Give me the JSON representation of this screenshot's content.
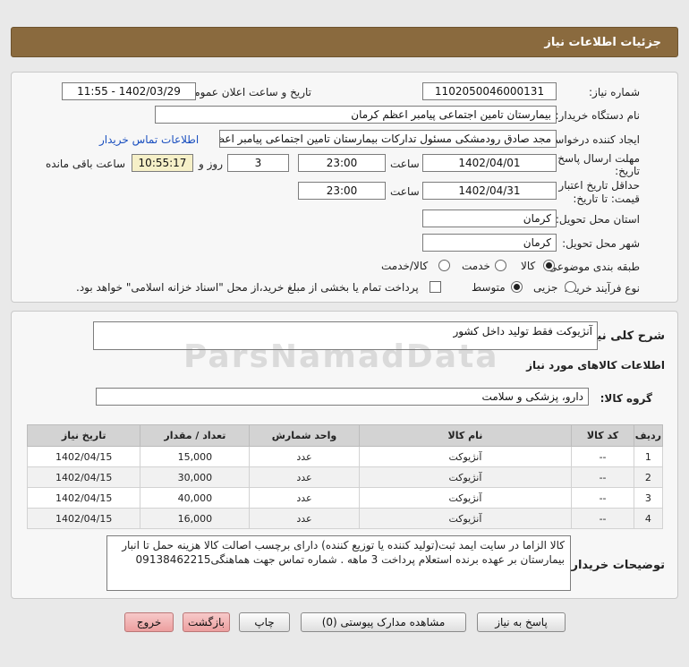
{
  "header": {
    "title": "جزئیات اطلاعات نیاز"
  },
  "form": {
    "need_number_label": "شماره نیاز:",
    "need_number": "1102050046000131",
    "announce_label": "تاریخ و ساعت اعلان عمومی:",
    "announce_value": "1402/03/29 - 11:55",
    "buyer_org_label": "نام دستگاه خریدار:",
    "buyer_org": "بیمارستان تامین اجتماعی پیامبر اعظم کرمان",
    "creator_label": "ایجاد کننده درخواست:",
    "creator": "مجد صادق  رودمشکی مسئول تدارکات بیمارستان تامین اجتماعی پیامبر اعظم کرمان",
    "contact_link": "اطلاعات تماس خریدار",
    "deadline_label_1": "مهلت ارسال پاسخ: تا",
    "deadline_label_2": "تاریخ:",
    "deadline_date": "1402/04/01",
    "time_label": "ساعت",
    "deadline_time": "23:00",
    "days_value": "3",
    "days_label": "روز و",
    "remaining_time": "10:55:17",
    "remaining_label": "ساعت باقی مانده",
    "validity_label_1": "حداقل تاریخ اعتبار",
    "validity_label_2": "قیمت: تا تاریخ:",
    "validity_date": "1402/04/31",
    "validity_time": "23:00",
    "province_label": "استان محل تحویل:",
    "province": "کرمان",
    "city_label": "شهر محل تحویل:",
    "city": "کرمان",
    "category_label": "طبقه بندی موضوعی:",
    "category_options": [
      "کالا",
      "خدمت",
      "کالا/خدمت"
    ],
    "process_label": "نوع فرآیند خرید :",
    "process_options": [
      "جزیی",
      "متوسط"
    ],
    "payment_note": "پرداخت تمام یا بخشی از مبلغ خرید،از محل \"اسناد خزانه اسلامی\" خواهد بود."
  },
  "summary": {
    "need_desc_label": "شرح کلی نیاز:",
    "need_desc": "آنژیوکت فقط تولید داخل کشور",
    "goods_info_title": "اطلاعات کالاهای مورد نیاز",
    "goods_group_label": "گروه کالا:",
    "goods_group": "دارو، پزشکی و سلامت"
  },
  "table": {
    "headers": [
      "ردیف",
      "کد کالا",
      "نام کالا",
      "واحد شمارش",
      "تعداد / مقدار",
      "تاریخ نیاز"
    ],
    "rows": [
      [
        "1",
        "--",
        "آنژیوکت",
        "عدد",
        "15,000",
        "1402/04/15"
      ],
      [
        "2",
        "--",
        "آنژیوکت",
        "عدد",
        "30,000",
        "1402/04/15"
      ],
      [
        "3",
        "--",
        "آنژیوکت",
        "عدد",
        "40,000",
        "1402/04/15"
      ],
      [
        "4",
        "--",
        "آنژیوکت",
        "عدد",
        "16,000",
        "1402/04/15"
      ]
    ]
  },
  "buyer_notes": {
    "label": "توضیحات خریدار:",
    "line1": "کالا الزاما در سایت ایمد ثبت(تولید کننده یا توزیع کننده) دارای برچسب اصالت کالا هزینه حمل تا انبار",
    "line2": "بیمارستان بر عهده برنده استعلام پرداخت 3 ماهه . شماره تماس جهت هماهنگی09138462215"
  },
  "buttons": {
    "reply": "پاسخ به نیاز",
    "attachments": "مشاهده مدارک پیوستی (0)",
    "print": "چاپ",
    "back": "بازگشت",
    "exit": "خروج"
  },
  "watermark": "ParsNamadData",
  "colors": {
    "header": "#8a6a3e",
    "link": "#1a4fbf",
    "danger_button": "#ec9f9f"
  }
}
